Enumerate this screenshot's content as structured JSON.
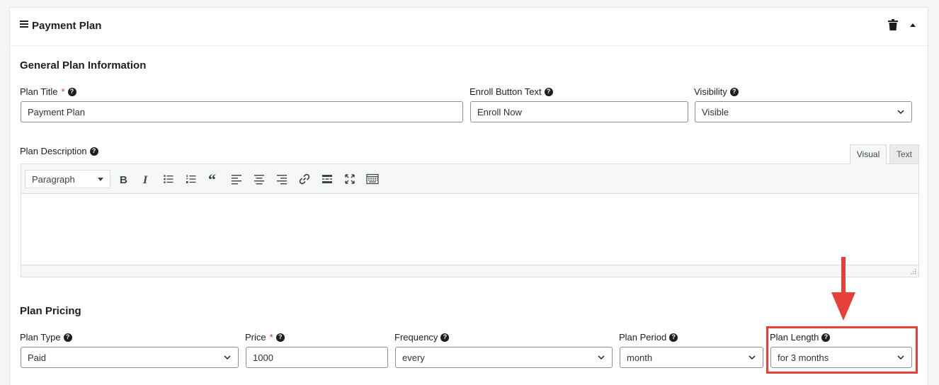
{
  "panel": {
    "title": "Payment Plan"
  },
  "general": {
    "heading": "General Plan Information",
    "plan_title": {
      "label": "Plan Title",
      "required": "*",
      "value": "Payment Plan"
    },
    "enroll_text": {
      "label": "Enroll Button Text",
      "value": "Enroll Now"
    },
    "visibility": {
      "label": "Visibility",
      "value": "Visible"
    }
  },
  "description": {
    "label": "Plan Description",
    "tabs": {
      "visual": "Visual",
      "text": "Text"
    },
    "format": "Paragraph",
    "toolbar_icons": [
      "bold-icon",
      "italic-icon",
      "bullet-list-icon",
      "numbered-list-icon",
      "blockquote-icon",
      "align-left-icon",
      "align-center-icon",
      "align-right-icon",
      "link-icon",
      "read-more-icon",
      "fullscreen-icon",
      "toolbar-toggle-icon"
    ]
  },
  "pricing": {
    "heading": "Plan Pricing",
    "plan_type": {
      "label": "Plan Type",
      "value": "Paid"
    },
    "price": {
      "label": "Price",
      "required": "*",
      "value": "1000"
    },
    "frequency": {
      "label": "Frequency",
      "value": "every"
    },
    "plan_period": {
      "label": "Plan Period",
      "value": "month"
    },
    "plan_length": {
      "label": "Plan Length",
      "value": "for 3 months"
    }
  },
  "colors": {
    "annotation": "#e5403a",
    "required": "#d63638"
  }
}
